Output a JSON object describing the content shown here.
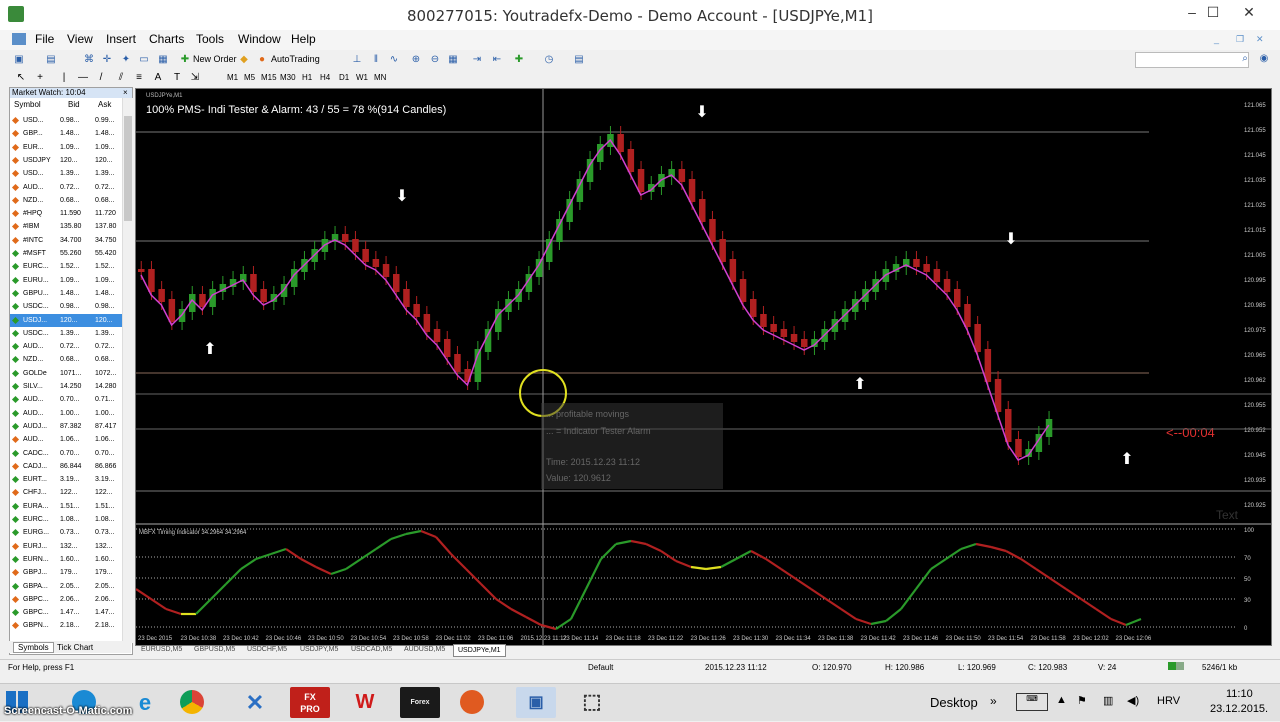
{
  "window": {
    "title": "800277015: Youtradefx-Demo - Demo Account - [USDJPYe,M1]",
    "minimize": "–",
    "maximize": "☐",
    "close": "✕"
  },
  "menu": [
    "File",
    "View",
    "Insert",
    "Charts",
    "Tools",
    "Window",
    "Help"
  ],
  "toolbar": {
    "new_order": "New Order",
    "autotrading": "AutoTrading",
    "timeframes": [
      "M1",
      "M5",
      "M15",
      "M30",
      "H1",
      "H4",
      "D1",
      "W1",
      "MN"
    ]
  },
  "market_watch": {
    "header": "Market Watch: 10:04",
    "columns": {
      "symbol": "Symbol",
      "bid": "Bid",
      "ask": "Ask"
    },
    "rows": [
      {
        "symbol": "USD...",
        "bid": "0.98...",
        "ask": "0.99...",
        "color": "#e06a1a"
      },
      {
        "symbol": "GBP...",
        "bid": "1.48...",
        "ask": "1.48...",
        "color": "#e06a1a"
      },
      {
        "symbol": "EUR...",
        "bid": "1.09...",
        "ask": "1.09...",
        "color": "#e06a1a"
      },
      {
        "symbol": "USDJPY",
        "bid": "120...",
        "ask": "120...",
        "color": "#e06a1a"
      },
      {
        "symbol": "USD...",
        "bid": "1.39...",
        "ask": "1.39...",
        "color": "#e06a1a"
      },
      {
        "symbol": "AUD...",
        "bid": "0.72...",
        "ask": "0.72...",
        "color": "#e06a1a"
      },
      {
        "symbol": "NZD...",
        "bid": "0.68...",
        "ask": "0.68...",
        "color": "#e06a1a"
      },
      {
        "symbol": "#HPQ",
        "bid": "11.590",
        "ask": "11.720",
        "color": "#e06a1a"
      },
      {
        "symbol": "#IBM",
        "bid": "135.80",
        "ask": "137.80",
        "color": "#e06a1a"
      },
      {
        "symbol": "#INTC",
        "bid": "34.700",
        "ask": "34.750",
        "color": "#e06a1a"
      },
      {
        "symbol": "#MSFT",
        "bid": "55.260",
        "ask": "55.420",
        "color": "#2a9a2a"
      },
      {
        "symbol": "EURC...",
        "bid": "1.52...",
        "ask": "1.52...",
        "color": "#2a9a2a"
      },
      {
        "symbol": "EURU...",
        "bid": "1.09...",
        "ask": "1.09...",
        "color": "#2a9a2a"
      },
      {
        "symbol": "GBPU...",
        "bid": "1.48...",
        "ask": "1.48...",
        "color": "#2a9a2a"
      },
      {
        "symbol": "USDC...",
        "bid": "0.98...",
        "ask": "0.98...",
        "color": "#2a9a2a"
      },
      {
        "symbol": "USDJ...",
        "bid": "120...",
        "ask": "120...",
        "color": "#2a9a2a"
      },
      {
        "symbol": "USDC...",
        "bid": "1.39...",
        "ask": "1.39...",
        "color": "#2a9a2a"
      },
      {
        "symbol": "AUD...",
        "bid": "0.72...",
        "ask": "0.72...",
        "color": "#2a9a2a"
      },
      {
        "symbol": "NZD...",
        "bid": "0.68...",
        "ask": "0.68...",
        "color": "#2a9a2a"
      },
      {
        "symbol": "GOLDe",
        "bid": "1071...",
        "ask": "1072...",
        "color": "#2a9a2a"
      },
      {
        "symbol": "SILV...",
        "bid": "14.250",
        "ask": "14.280",
        "color": "#2a9a2a"
      },
      {
        "symbol": "AUD...",
        "bid": "0.70...",
        "ask": "0.71...",
        "color": "#2a9a2a"
      },
      {
        "symbol": "AUD...",
        "bid": "1.00...",
        "ask": "1.00...",
        "color": "#2a9a2a"
      },
      {
        "symbol": "AUDJ...",
        "bid": "87.382",
        "ask": "87.417",
        "color": "#2a9a2a"
      },
      {
        "symbol": "AUD...",
        "bid": "1.06...",
        "ask": "1.06...",
        "color": "#e06a1a"
      },
      {
        "symbol": "CADC...",
        "bid": "0.70...",
        "ask": "0.70...",
        "color": "#2a9a2a"
      },
      {
        "symbol": "CADJ...",
        "bid": "86.844",
        "ask": "86.866",
        "color": "#e06a1a"
      },
      {
        "symbol": "EURT...",
        "bid": "3.19...",
        "ask": "3.19...",
        "color": "#2a9a2a"
      },
      {
        "symbol": "CHFJ...",
        "bid": "122...",
        "ask": "122...",
        "color": "#e06a1a"
      },
      {
        "symbol": "EURA...",
        "bid": "1.51...",
        "ask": "1.51...",
        "color": "#2a9a2a"
      },
      {
        "symbol": "EURC...",
        "bid": "1.08...",
        "ask": "1.08...",
        "color": "#2a9a2a"
      },
      {
        "symbol": "EURG...",
        "bid": "0.73...",
        "ask": "0.73...",
        "color": "#2a9a2a"
      },
      {
        "symbol": "EURJ...",
        "bid": "132...",
        "ask": "132...",
        "color": "#e06a1a"
      },
      {
        "symbol": "EURN...",
        "bid": "1.60...",
        "ask": "1.60...",
        "color": "#2a9a2a"
      },
      {
        "symbol": "GBPJ...",
        "bid": "179...",
        "ask": "179...",
        "color": "#e06a1a"
      },
      {
        "symbol": "GBPA...",
        "bid": "2.05...",
        "ask": "2.05...",
        "color": "#2a9a2a"
      },
      {
        "symbol": "GBPC...",
        "bid": "2.06...",
        "ask": "2.06...",
        "color": "#e06a1a"
      },
      {
        "symbol": "GBPC...",
        "bid": "1.47...",
        "ask": "1.47...",
        "color": "#2a9a2a"
      },
      {
        "symbol": "GBPN...",
        "bid": "2.18...",
        "ask": "2.18...",
        "color": "#e06a1a"
      }
    ],
    "selected_index": 15,
    "tabs": [
      "Symbols",
      "Tick Chart"
    ]
  },
  "chart": {
    "symbol_label": "USDJPYe,M1",
    "info_text": "100% PMS- Indi Tester & Alarm: 43 / 55 = 78 %(914 Candles)",
    "countdown": "<--00:04",
    "price_labels": [
      "121.065",
      "121.055",
      "121.045",
      "121.035",
      "121.025",
      "121.015",
      "121.005",
      "120.995",
      "120.985",
      "120.975",
      "120.965",
      "120.962",
      "120.955",
      "120.952",
      "120.945",
      "120.935",
      "120.925"
    ],
    "tooltip": [
      "... profitable movings",
      "... = Indicator Tester Alarm",
      "Time: 2015.12.23 11:12",
      "Value: 120.9612"
    ],
    "watermark": "Text",
    "indicator_label": "MBFX Timing Indicator 34.2964 34.2964",
    "indicator_levels": [
      "100",
      "70",
      "50",
      "30",
      "0"
    ],
    "time_labels": [
      "23 Dec 2015",
      "23 Dec 10:38",
      "23 Dec 10:42",
      "23 Dec 10:46",
      "23 Dec 10:50",
      "23 Dec 10:54",
      "23 Dec 10:58",
      "23 Dec 11:02",
      "23 Dec 11:06",
      "2015.12.23 11:12",
      "23 Dec 11:14",
      "23 Dec 11:18",
      "23 Dec 11:22",
      "23 Dec 11:26",
      "23 Dec 11:30",
      "23 Dec 11:34",
      "23 Dec 11:38",
      "23 Dec 11:42",
      "23 Dec 11:46",
      "23 Dec 11:50",
      "23 Dec 11:54",
      "23 Dec 11:58",
      "23 Dec 12:02",
      "23 Dec 12:06"
    ]
  },
  "chart_tabs": [
    "EURUSD,M5",
    "GBPUSD,M5",
    "USDCHF,M5",
    "USDJPY,M5",
    "USDCAD,M5",
    "AUDUSD,M5",
    "USDJPYe,M1"
  ],
  "status": {
    "help": "For Help, press F1",
    "profile": "Default",
    "datetime": "2015.12.23 11:12",
    "open": "O: 120.970",
    "high": "H: 120.986",
    "low": "L: 120.969",
    "close": "C: 120.983",
    "volume": "V: 24",
    "traffic": "5246/1 kb"
  },
  "taskbar": {
    "apps": [
      "Screencast",
      "IE",
      "Chrome",
      "X",
      "FX PRO",
      "W",
      "Forex",
      "Fx",
      "Explorer",
      "Snip"
    ],
    "desktop": "Desktop",
    "lang": "HRV",
    "time": "11:10",
    "date": "23.12.2015.",
    "watermark": "Screencast-O-Matic.com"
  }
}
